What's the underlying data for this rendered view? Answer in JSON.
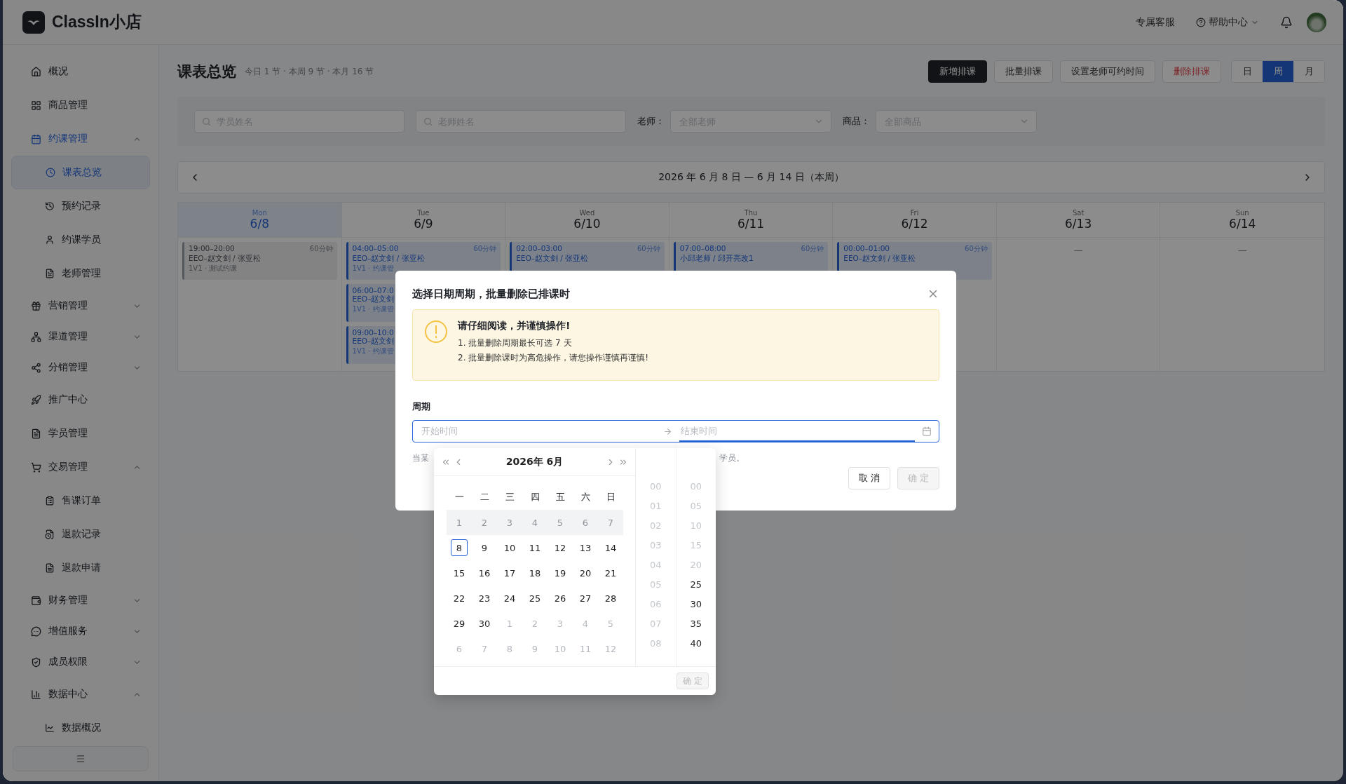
{
  "header": {
    "brand": "ClassIn小店",
    "links": [
      {
        "label": "专属客服",
        "kind": "text"
      },
      {
        "label": "帮助中心",
        "kind": "help"
      }
    ]
  },
  "sidebar": {
    "items": [
      {
        "label": "概况",
        "selected": false
      },
      {
        "label": "商品管理",
        "selected": false
      },
      {
        "label": "约课管理",
        "selected": false,
        "expanded": true,
        "children": [
          {
            "label": "课表总览",
            "selected": true
          },
          {
            "label": "预约记录",
            "selected": false
          },
          {
            "label": "约课学员",
            "selected": false
          },
          {
            "label": "老师管理",
            "selected": false
          }
        ]
      },
      {
        "label": "营销管理",
        "selected": false,
        "expanded": false
      },
      {
        "label": "渠道管理",
        "selected": false,
        "expanded": false
      },
      {
        "label": "分销管理",
        "selected": false,
        "expanded": false
      },
      {
        "label": "推广中心",
        "selected": false
      },
      {
        "label": "学员管理",
        "selected": false
      },
      {
        "label": "交易管理",
        "selected": false,
        "expanded": true,
        "children": [
          {
            "label": "售课订单",
            "selected": false
          },
          {
            "label": "退款记录",
            "selected": false
          },
          {
            "label": "退款申请",
            "selected": false
          }
        ]
      },
      {
        "label": "财务管理",
        "selected": false,
        "expanded": false
      },
      {
        "label": "增值服务",
        "selected": false,
        "expanded": false
      },
      {
        "label": "成员权限",
        "selected": false,
        "expanded": false
      },
      {
        "label": "数据中心",
        "selected": false,
        "expanded": true,
        "children": [
          {
            "label": "数据概况",
            "selected": false
          }
        ]
      }
    ]
  },
  "page": {
    "title": "课表总览",
    "summary": "今日 1 节 · 本周 9 节 · 本月 16 节",
    "actions": [
      {
        "label": "新增排课",
        "kind": "primary"
      },
      {
        "label": "批量排课",
        "kind": "default"
      },
      {
        "label": "设置老师可约时间",
        "kind": "default"
      },
      {
        "label": "删除排课",
        "kind": "danger"
      }
    ],
    "views": [
      {
        "label": "日",
        "selected": false
      },
      {
        "label": "周",
        "selected": true
      },
      {
        "label": "月",
        "selected": false
      }
    ]
  },
  "filters": {
    "student_search": {
      "placeholder": "学员姓名"
    },
    "teacher_search": {
      "placeholder": "老师姓名"
    },
    "selects": [
      {
        "label": "老师：",
        "placeholder": "全部老师"
      },
      {
        "label": "商品：",
        "placeholder": "全部商品"
      }
    ]
  },
  "week": {
    "range": "2026 年 6 月 8 日 — 6 月 14 日（本周）"
  },
  "calendar": {
    "days": [
      {
        "weekday": "Mon",
        "date": "6/8",
        "selected": true,
        "events": [
          {
            "kind": "past",
            "time": "19:00–20:00",
            "duration": "60分钟",
            "title": "EEO–赵文剑 / 张亚松",
            "note": "1V1 · 测试约课"
          }
        ]
      },
      {
        "weekday": "Tue",
        "date": "6/9",
        "selected": false,
        "events": [
          {
            "kind": "upcoming",
            "time": "04:00–05:00",
            "duration": "60分钟",
            "title": "EEO–赵文剑 / 张亚松",
            "note": "1V1 · 约课管"
          },
          {
            "kind": "upcoming",
            "time": "06:00–07:0",
            "title": "EEO–赵文剑",
            "note": "1V1 · 约课管"
          },
          {
            "kind": "upcoming",
            "time": "09:00–10:0",
            "title": "EEO–赵文剑",
            "note": "1V1 · 约课管"
          }
        ]
      },
      {
        "weekday": "Wed",
        "date": "6/10",
        "selected": false,
        "events": [
          {
            "kind": "upcoming",
            "time": "02:00–03:00",
            "duration": "60分钟",
            "title": "EEO–赵文剑 / 张亚松"
          }
        ]
      },
      {
        "weekday": "Thu",
        "date": "6/11",
        "selected": false,
        "events": [
          {
            "kind": "upcoming",
            "time": "07:00–08:00",
            "duration": "60分钟",
            "title": "小邱老师 / 邱开亮改1"
          }
        ]
      },
      {
        "weekday": "Fri",
        "date": "6/12",
        "selected": false,
        "events": [
          {
            "kind": "upcoming",
            "time": "00:00–01:00",
            "duration": "60分钟",
            "title": "EEO–赵文剑 / 张亚松"
          }
        ]
      },
      {
        "weekday": "Sat",
        "date": "6/13",
        "selected": false,
        "empty": "—"
      },
      {
        "weekday": "Sun",
        "date": "6/14",
        "selected": false,
        "empty": "—"
      }
    ]
  },
  "dialog": {
    "title": "选择日期周期，批量删除已排课时",
    "alert": {
      "heading": "请仔细阅读，并谨慎操作!",
      "items": [
        "1. 批量删除周期最长可选 7 天",
        "2. 批量删除课时为高危操作，请您操作谨慎再谨慎!"
      ]
    },
    "field_label": "周期",
    "start": {
      "placeholder": "开始时间"
    },
    "end": {
      "placeholder": "结束时间"
    },
    "hint_start": "当某",
    "hint_end": "学员。",
    "buttons": [
      {
        "label": "取 消",
        "disabled": false
      },
      {
        "label": "确 定",
        "disabled": true
      }
    ],
    "picker": {
      "month": "2026年  6月",
      "weekdays": [
        "一",
        "二",
        "三",
        "四",
        "五",
        "六",
        "日"
      ],
      "weeks": [
        [
          {
            "label": "1",
            "kind": "disabled"
          },
          {
            "label": "2",
            "kind": "disabled"
          },
          {
            "label": "3",
            "kind": "disabled"
          },
          {
            "label": "4",
            "kind": "disabled"
          },
          {
            "label": "5",
            "kind": "disabled"
          },
          {
            "label": "6",
            "kind": "disabled"
          },
          {
            "label": "7",
            "kind": "disabled"
          }
        ],
        [
          {
            "label": "8",
            "kind": "today"
          },
          {
            "label": "9",
            "kind": "day"
          },
          {
            "label": "10",
            "kind": "day"
          },
          {
            "label": "11",
            "kind": "day"
          },
          {
            "label": "12",
            "kind": "day"
          },
          {
            "label": "13",
            "kind": "day"
          },
          {
            "label": "14",
            "kind": "day"
          }
        ],
        [
          {
            "label": "15",
            "kind": "day"
          },
          {
            "label": "16",
            "kind": "day"
          },
          {
            "label": "17",
            "kind": "day"
          },
          {
            "label": "18",
            "kind": "day"
          },
          {
            "label": "19",
            "kind": "day"
          },
          {
            "label": "20",
            "kind": "day"
          },
          {
            "label": "21",
            "kind": "day"
          }
        ],
        [
          {
            "label": "22",
            "kind": "day"
          },
          {
            "label": "23",
            "kind": "day"
          },
          {
            "label": "24",
            "kind": "day"
          },
          {
            "label": "25",
            "kind": "day"
          },
          {
            "label": "26",
            "kind": "day"
          },
          {
            "label": "27",
            "kind": "day"
          },
          {
            "label": "28",
            "kind": "day"
          }
        ],
        [
          {
            "label": "29",
            "kind": "day"
          },
          {
            "label": "30",
            "kind": "day"
          },
          {
            "label": "1",
            "kind": "adjacent"
          },
          {
            "label": "2",
            "kind": "adjacent"
          },
          {
            "label": "3",
            "kind": "adjacent"
          },
          {
            "label": "4",
            "kind": "adjacent"
          },
          {
            "label": "5",
            "kind": "adjacent"
          }
        ],
        [
          {
            "label": "6",
            "kind": "adjacent"
          },
          {
            "label": "7",
            "kind": "adjacent"
          },
          {
            "label": "8",
            "kind": "adjacent"
          },
          {
            "label": "9",
            "kind": "adjacent"
          },
          {
            "label": "10",
            "kind": "adjacent"
          },
          {
            "label": "11",
            "kind": "adjacent"
          },
          {
            "label": "12",
            "kind": "adjacent"
          }
        ]
      ],
      "hours": [
        {
          "label": "00",
          "disabled": true
        },
        {
          "label": "01",
          "disabled": true
        },
        {
          "label": "02",
          "disabled": true
        },
        {
          "label": "03",
          "disabled": true
        },
        {
          "label": "04",
          "disabled": true
        },
        {
          "label": "05",
          "disabled": true
        },
        {
          "label": "06",
          "disabled": true
        },
        {
          "label": "07",
          "disabled": true
        },
        {
          "label": "08",
          "disabled": true
        }
      ],
      "minutes": [
        {
          "label": "00",
          "disabled": true
        },
        {
          "label": "05",
          "disabled": true
        },
        {
          "label": "10",
          "disabled": true
        },
        {
          "label": "15",
          "disabled": true
        },
        {
          "label": "20",
          "disabled": true
        },
        {
          "label": "25",
          "disabled": false
        },
        {
          "label": "30",
          "disabled": false
        },
        {
          "label": "35",
          "disabled": false
        },
        {
          "label": "40",
          "disabled": false
        }
      ],
      "ok": {
        "label": "确 定",
        "disabled": true
      }
    }
  }
}
